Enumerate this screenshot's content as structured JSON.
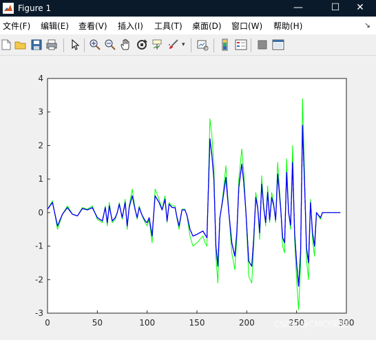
{
  "window": {
    "title": "Figure 1",
    "minimize": "—",
    "maximize": "☐",
    "close": "✕"
  },
  "menu": {
    "items": [
      "文件(F)",
      "编辑(E)",
      "查看(V)",
      "插入(I)",
      "工具(T)",
      "桌面(D)",
      "窗口(W)",
      "帮助(H)"
    ],
    "right_arrow": "↘"
  },
  "toolbar": {
    "icons": [
      "new-figure-icon",
      "open-file-icon",
      "save-icon",
      "print-icon",
      "select-arrow-icon",
      "zoom-in-icon",
      "zoom-out-icon",
      "pan-hand-icon",
      "rotate-3d-icon",
      "data-cursor-icon",
      "brush-icon",
      "brush-dropdown-icon",
      "link-plot-icon",
      "colorbar-icon",
      "legend-icon",
      "hide-plot-tools-icon",
      "show-plot-tools-icon"
    ]
  },
  "watermark": "CSDN @CMCY阿探",
  "colors": {
    "green": "#00ff00",
    "blue": "#0000ff",
    "orange": "#e5600a",
    "titlebar": "#0b1a2b"
  },
  "chart_data": {
    "type": "line",
    "xlim": [
      0,
      300
    ],
    "ylim": [
      -3,
      4
    ],
    "xticks": [
      "0",
      "50",
      "100",
      "150",
      "200",
      "250",
      "300"
    ],
    "yticks": [
      "-3",
      "-2",
      "-1",
      "0",
      "1",
      "2",
      "3",
      "4"
    ],
    "title": "",
    "xlabel": "",
    "ylabel": "",
    "grid": false,
    "series": [
      {
        "color": "#00ff00",
        "dash": "",
        "x": [
          0,
          5,
          10,
          15,
          20,
          25,
          30,
          35,
          40,
          45,
          50,
          55,
          58,
          60,
          62,
          65,
          68,
          70,
          72,
          75,
          78,
          80,
          82,
          85,
          88,
          90,
          92,
          95,
          98,
          100,
          102,
          105,
          108,
          112,
          115,
          118,
          120,
          122,
          125,
          128,
          130,
          132,
          135,
          138,
          140,
          143,
          146,
          150,
          153,
          156,
          158,
          160,
          163,
          165,
          167,
          169,
          171,
          173,
          176,
          179,
          182,
          185,
          188,
          190,
          192,
          195,
          197,
          199,
          202,
          205,
          207,
          209,
          211,
          213,
          215,
          217,
          219,
          221,
          223,
          225,
          227,
          229,
          231,
          234,
          236,
          238,
          240,
          242,
          244,
          246,
          248,
          250,
          252,
          254,
          256,
          258,
          260,
          262,
          264,
          266,
          268,
          270,
          272,
          274,
          276,
          278,
          280,
          282,
          284,
          286,
          288,
          290,
          292,
          294
        ],
        "y": [
          0.1,
          0.35,
          -0.5,
          -0.05,
          0.2,
          -0.05,
          -0.1,
          0.15,
          0.1,
          0.2,
          -0.2,
          -0.3,
          0.2,
          -0.4,
          0.3,
          -0.3,
          -0.2,
          0.0,
          0.3,
          -0.2,
          0.4,
          -0.5,
          0.2,
          0.7,
          0.1,
          -0.2,
          0.2,
          -0.1,
          -0.3,
          -0.4,
          -0.2,
          -0.9,
          0.7,
          0.4,
          0.1,
          0.5,
          -0.3,
          0.3,
          0.2,
          0.2,
          -0.2,
          -0.5,
          0.1,
          0.1,
          -0.1,
          -0.7,
          -1.0,
          -0.9,
          -0.8,
          -0.7,
          -0.9,
          -1.0,
          2.8,
          2.3,
          1.4,
          -1.3,
          -2.1,
          -0.2,
          0.5,
          1.4,
          0.0,
          -1.2,
          -1.7,
          -0.8,
          1.0,
          1.9,
          1.2,
          0.1,
          -1.9,
          -2.1,
          -1.0,
          0.6,
          0.2,
          -0.8,
          1.1,
          0.2,
          -0.4,
          0.8,
          -0.3,
          0.6,
          0.3,
          -0.3,
          1.5,
          0.2,
          -1.0,
          -1.2,
          1.6,
          0.0,
          -0.5,
          2.0,
          -0.8,
          -2.0,
          -2.9,
          -1.6,
          3.4,
          1.2,
          -1.4,
          -2.0,
          0.4,
          -0.8,
          -1.3,
          0.0,
          -0.1,
          -0.2,
          0.0,
          0.0,
          0.0,
          0.0,
          0.0,
          0.0,
          0.0,
          0.0,
          0.0,
          0.0
        ]
      },
      {
        "color": "#e5600a",
        "dash": "5,4",
        "x": [
          0,
          5,
          10,
          15,
          20,
          25,
          30,
          35,
          40,
          45,
          50,
          55,
          58,
          60,
          62,
          65,
          68,
          70,
          72,
          75,
          78,
          80,
          82,
          85,
          88,
          90,
          92,
          95,
          98,
          100,
          102,
          105,
          108,
          112,
          115,
          118,
          120,
          122,
          125,
          128,
          130,
          132,
          135,
          138,
          140,
          143,
          146,
          150,
          153,
          156,
          158,
          160,
          163,
          165,
          167,
          169,
          171,
          173,
          176,
          179,
          182,
          185,
          188,
          190,
          192,
          195,
          197,
          199,
          202,
          205,
          207,
          209,
          211,
          213,
          215,
          217,
          219,
          221,
          223,
          225,
          227,
          229,
          231,
          234,
          236,
          238,
          240,
          242,
          244,
          246,
          248,
          250,
          252,
          254,
          256,
          258,
          260,
          262,
          264,
          266,
          268,
          270,
          272,
          274,
          276,
          278,
          280,
          282,
          284,
          286,
          288,
          290,
          292,
          294
        ],
        "y": [
          0.1,
          0.3,
          -0.4,
          -0.05,
          0.15,
          -0.05,
          -0.1,
          0.12,
          0.08,
          0.15,
          -0.15,
          -0.25,
          0.15,
          -0.3,
          0.2,
          -0.25,
          -0.15,
          0.0,
          0.25,
          -0.15,
          0.3,
          -0.4,
          0.15,
          0.5,
          0.08,
          -0.15,
          0.15,
          -0.08,
          -0.25,
          -0.3,
          -0.15,
          -0.7,
          0.5,
          0.3,
          0.08,
          0.4,
          -0.25,
          0.25,
          0.15,
          0.15,
          -0.15,
          -0.4,
          0.08,
          0.08,
          -0.08,
          -0.5,
          -0.7,
          -0.65,
          -0.6,
          -0.55,
          -0.65,
          -0.75,
          2.2,
          1.7,
          1.0,
          -1.0,
          -1.6,
          -0.15,
          0.4,
          1.05,
          0.0,
          -0.9,
          -1.3,
          -0.6,
          0.75,
          1.45,
          0.9,
          0.08,
          -1.45,
          -1.6,
          -0.75,
          0.45,
          0.15,
          -0.6,
          0.85,
          0.15,
          -0.3,
          0.6,
          -0.22,
          0.45,
          0.22,
          -0.22,
          1.15,
          0.15,
          -0.75,
          -0.9,
          1.2,
          0.0,
          -0.38,
          1.5,
          -0.6,
          -1.5,
          -2.2,
          -1.2,
          2.6,
          0.9,
          -1.05,
          -1.5,
          0.3,
          -0.6,
          -1.0,
          0.0,
          -0.08,
          -0.15,
          0.0,
          0.0,
          0.0,
          0.0,
          0.0,
          0.0,
          0.0,
          0.0,
          0.0,
          0.0
        ]
      },
      {
        "color": "#0000ff",
        "dash": "",
        "x": [
          0,
          5,
          10,
          15,
          20,
          25,
          30,
          35,
          40,
          45,
          50,
          55,
          58,
          60,
          62,
          65,
          68,
          70,
          72,
          75,
          78,
          80,
          82,
          85,
          88,
          90,
          92,
          95,
          98,
          100,
          102,
          105,
          108,
          112,
          115,
          118,
          120,
          122,
          125,
          128,
          130,
          132,
          135,
          138,
          140,
          143,
          146,
          150,
          153,
          156,
          158,
          160,
          163,
          165,
          167,
          169,
          171,
          173,
          176,
          179,
          182,
          185,
          188,
          190,
          192,
          195,
          197,
          199,
          202,
          205,
          207,
          209,
          211,
          213,
          215,
          217,
          219,
          221,
          223,
          225,
          227,
          229,
          231,
          234,
          236,
          238,
          240,
          242,
          244,
          246,
          248,
          250,
          252,
          254,
          256,
          258,
          260,
          262,
          264,
          266,
          268,
          270,
          272,
          274,
          276,
          278,
          280,
          282,
          284,
          286,
          288,
          290,
          292,
          294
        ],
        "y": [
          0.1,
          0.3,
          -0.4,
          -0.05,
          0.15,
          -0.05,
          -0.1,
          0.12,
          0.08,
          0.15,
          -0.15,
          -0.25,
          0.15,
          -0.3,
          0.2,
          -0.25,
          -0.15,
          0.0,
          0.25,
          -0.15,
          0.3,
          -0.4,
          0.15,
          0.5,
          0.08,
          -0.15,
          0.15,
          -0.08,
          -0.25,
          -0.3,
          -0.15,
          -0.7,
          0.5,
          0.3,
          0.08,
          0.4,
          -0.25,
          0.25,
          0.15,
          0.15,
          -0.15,
          -0.4,
          0.08,
          0.08,
          -0.08,
          -0.5,
          -0.7,
          -0.65,
          -0.6,
          -0.55,
          -0.65,
          -0.75,
          2.2,
          1.7,
          1.0,
          -1.0,
          -1.6,
          -0.15,
          0.4,
          1.05,
          0.0,
          -0.9,
          -1.3,
          -0.6,
          0.75,
          1.45,
          0.9,
          0.08,
          -1.45,
          -1.6,
          -0.75,
          0.45,
          0.15,
          -0.6,
          0.85,
          0.15,
          -0.3,
          0.6,
          -0.22,
          0.45,
          0.22,
          -0.22,
          1.15,
          0.15,
          -0.75,
          -0.9,
          1.2,
          0.0,
          -0.38,
          1.5,
          -0.6,
          -1.5,
          -2.2,
          -1.2,
          2.6,
          0.9,
          -1.05,
          -1.5,
          0.3,
          -0.6,
          -1.0,
          0.0,
          -0.08,
          -0.15,
          0.0,
          0.0,
          0.0,
          0.0,
          0.0,
          0.0,
          0.0,
          0.0,
          0.0,
          0.0
        ]
      }
    ]
  }
}
